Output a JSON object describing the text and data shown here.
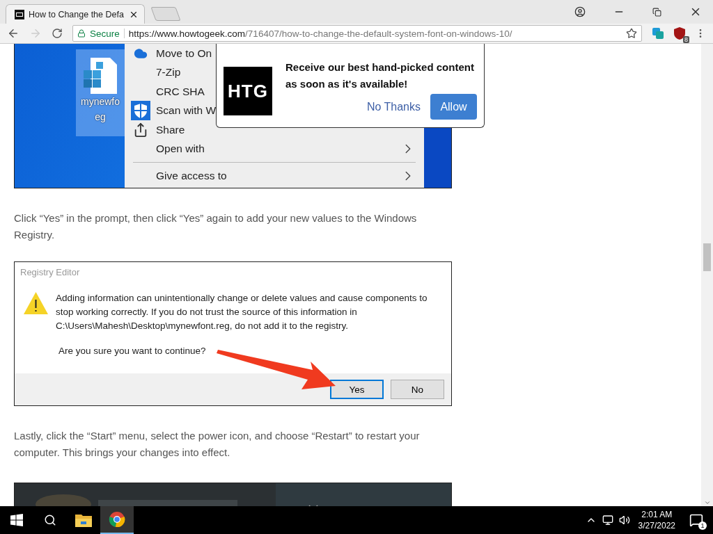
{
  "browser": {
    "tab_title": "How to Change the Defa",
    "security": "Secure",
    "url_host": "https://www.howtogeek.com",
    "url_path": "/716407/how-to-change-the-default-system-font-on-windows-10/",
    "extension_badge": "8"
  },
  "article": [
    {
      "kind": "menu-shot",
      "file_label": [
        "mynewfo",
        "eg"
      ],
      "items": [
        {
          "label": "Move to On",
          "kind": "cloud",
          "divider_before": false
        },
        {
          "label": "7-Zip",
          "kind": "plain",
          "divider_before": false
        },
        {
          "label": "CRC SHA",
          "kind": "plain",
          "divider_before": false
        },
        {
          "label": "Scan with W",
          "kind": "shield",
          "divider_before": false
        },
        {
          "label": "Share",
          "kind": "share",
          "submenu": false,
          "divider_before": false
        },
        {
          "label": "Open with",
          "kind": "plain",
          "submenu": true,
          "divider_before": false
        },
        {
          "label": "Give access to",
          "kind": "plain",
          "submenu": true,
          "divider_before": true
        }
      ]
    },
    {
      "kind": "paragraph",
      "text": "Click “Yes” in the prompt, then click “Yes” again to add your new values to the Windows Registry."
    },
    {
      "kind": "dialog-shot",
      "title": "Registry Editor",
      "message": [
        "Adding information can unintentionally change or delete values and cause components to",
        "stop working correctly. If you do not trust the source of this information in",
        "C:\\Users\\Mahesh\\Desktop\\mynewfont.reg, do not add it to the registry."
      ],
      "question": "Are you sure you want to continue?",
      "buttons": [
        {
          "label": "Yes",
          "selected": true
        },
        {
          "label": "No",
          "selected": false
        }
      ]
    },
    {
      "kind": "paragraph",
      "text": "Lastly, click the “Start” menu, select the power icon, and choose “Restart” to restart your computer. This brings your changes into effect."
    },
    {
      "kind": "picture"
    }
  ],
  "notification": {
    "logo": "HTG",
    "message": "Receive our best hand-picked content as soon as it's available!",
    "decline": "No Thanks",
    "accept": "Allow"
  },
  "taskbar": {
    "apps": [
      {
        "kind": "folder",
        "selected": false
      },
      {
        "kind": "chrome",
        "selected": true
      }
    ],
    "time": "2:01 AM",
    "date": "3/27/2022",
    "notification_count": "1"
  }
}
